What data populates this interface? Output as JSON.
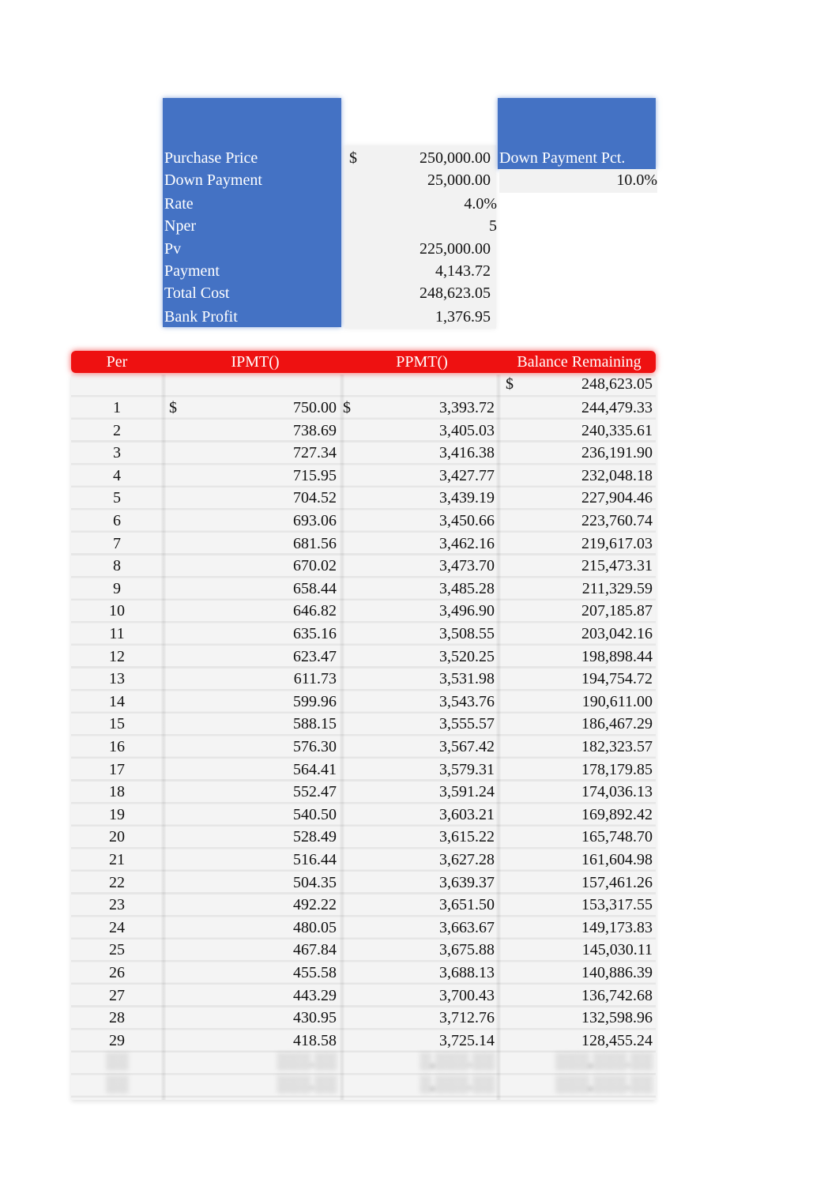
{
  "summary": {
    "currency_symbol": "$",
    "rows": [
      {
        "label": "Purchase Price",
        "value": "250,000.00",
        "show_currency": true
      },
      {
        "label": "Down Payment",
        "value": "25,000.00"
      },
      {
        "label": "Rate",
        "value": "4.0%"
      },
      {
        "label": "Nper",
        "value": "5"
      },
      {
        "label": "Pv",
        "value": "225,000.00"
      },
      {
        "label": "Payment",
        "value": "4,143.72"
      },
      {
        "label": "Total Cost",
        "value": "248,623.05"
      },
      {
        "label": "Bank Profit",
        "value": "1,376.95"
      }
    ],
    "down_payment_pct": {
      "label": "Down Payment Pct.",
      "value": "10.0%"
    }
  },
  "table": {
    "headers": [
      "Per",
      "IPMT()",
      "PPMT()",
      "Balance Remaining"
    ],
    "header_color": "#ee1111",
    "opening_balance": {
      "currency": "$",
      "value": "248,623.05"
    },
    "first_row_currency": "$",
    "rows": [
      {
        "per": "1",
        "ipmt": "750.00",
        "ppmt": "3,393.72",
        "balance": "244,479.33"
      },
      {
        "per": "2",
        "ipmt": "738.69",
        "ppmt": "3,405.03",
        "balance": "240,335.61"
      },
      {
        "per": "3",
        "ipmt": "727.34",
        "ppmt": "3,416.38",
        "balance": "236,191.90"
      },
      {
        "per": "4",
        "ipmt": "715.95",
        "ppmt": "3,427.77",
        "balance": "232,048.18"
      },
      {
        "per": "5",
        "ipmt": "704.52",
        "ppmt": "3,439.19",
        "balance": "227,904.46"
      },
      {
        "per": "6",
        "ipmt": "693.06",
        "ppmt": "3,450.66",
        "balance": "223,760.74"
      },
      {
        "per": "7",
        "ipmt": "681.56",
        "ppmt": "3,462.16",
        "balance": "219,617.03"
      },
      {
        "per": "8",
        "ipmt": "670.02",
        "ppmt": "3,473.70",
        "balance": "215,473.31"
      },
      {
        "per": "9",
        "ipmt": "658.44",
        "ppmt": "3,485.28",
        "balance": "211,329.59"
      },
      {
        "per": "10",
        "ipmt": "646.82",
        "ppmt": "3,496.90",
        "balance": "207,185.87"
      },
      {
        "per": "11",
        "ipmt": "635.16",
        "ppmt": "3,508.55",
        "balance": "203,042.16"
      },
      {
        "per": "12",
        "ipmt": "623.47",
        "ppmt": "3,520.25",
        "balance": "198,898.44"
      },
      {
        "per": "13",
        "ipmt": "611.73",
        "ppmt": "3,531.98",
        "balance": "194,754.72"
      },
      {
        "per": "14",
        "ipmt": "599.96",
        "ppmt": "3,543.76",
        "balance": "190,611.00"
      },
      {
        "per": "15",
        "ipmt": "588.15",
        "ppmt": "3,555.57",
        "balance": "186,467.29"
      },
      {
        "per": "16",
        "ipmt": "576.30",
        "ppmt": "3,567.42",
        "balance": "182,323.57"
      },
      {
        "per": "17",
        "ipmt": "564.41",
        "ppmt": "3,579.31",
        "balance": "178,179.85"
      },
      {
        "per": "18",
        "ipmt": "552.47",
        "ppmt": "3,591.24",
        "balance": "174,036.13"
      },
      {
        "per": "19",
        "ipmt": "540.50",
        "ppmt": "3,603.21",
        "balance": "169,892.42"
      },
      {
        "per": "20",
        "ipmt": "528.49",
        "ppmt": "3,615.22",
        "balance": "165,748.70"
      },
      {
        "per": "21",
        "ipmt": "516.44",
        "ppmt": "3,627.28",
        "balance": "161,604.98"
      },
      {
        "per": "22",
        "ipmt": "504.35",
        "ppmt": "3,639.37",
        "balance": "157,461.26"
      },
      {
        "per": "23",
        "ipmt": "492.22",
        "ppmt": "3,651.50",
        "balance": "153,317.55"
      },
      {
        "per": "24",
        "ipmt": "480.05",
        "ppmt": "3,663.67",
        "balance": "149,173.83"
      },
      {
        "per": "25",
        "ipmt": "467.84",
        "ppmt": "3,675.88",
        "balance": "145,030.11"
      },
      {
        "per": "26",
        "ipmt": "455.58",
        "ppmt": "3,688.13",
        "balance": "140,886.39"
      },
      {
        "per": "27",
        "ipmt": "443.29",
        "ppmt": "3,700.43",
        "balance": "136,742.68"
      },
      {
        "per": "28",
        "ipmt": "430.95",
        "ppmt": "3,712.76",
        "balance": "132,598.96"
      },
      {
        "per": "29",
        "ipmt": "418.58",
        "ppmt": "3,725.14",
        "balance": "128,455.24"
      }
    ],
    "obscured_rows": [
      {
        "per": "░░",
        "ipmt": "░░░.░░",
        "ppmt": "░,░░░.░░",
        "balance": "░░░,░░░.░░"
      },
      {
        "per": "░░",
        "ipmt": "░░░.░░",
        "ppmt": "░,░░░.░░",
        "balance": "░░░,░░░.░░"
      }
    ]
  }
}
